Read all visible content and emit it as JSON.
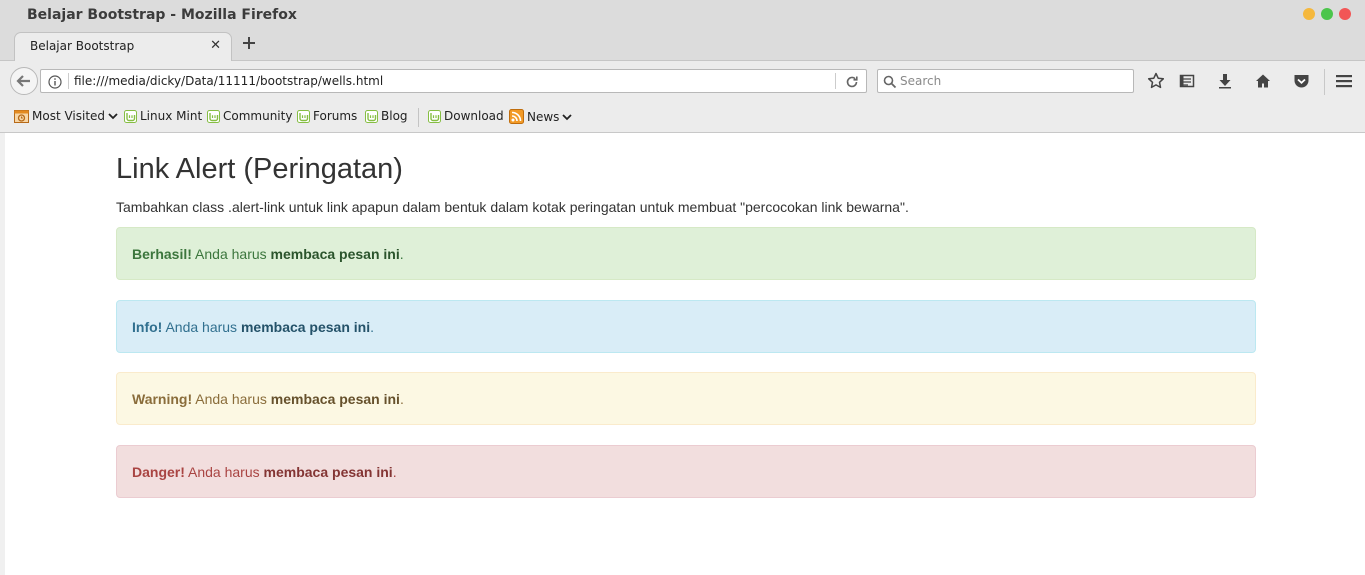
{
  "window": {
    "title": "Belajar Bootstrap - Mozilla Firefox",
    "controls": [
      {
        "name": "minimize",
        "color": "#f5b83d"
      },
      {
        "name": "maximize",
        "color": "#4cc54c"
      },
      {
        "name": "close",
        "color": "#f25656"
      }
    ]
  },
  "tab": {
    "label": "Belajar Bootstrap",
    "close": "✕"
  },
  "navbar": {
    "url": "file:///media/dicky/Data/11111/bootstrap/wells.html",
    "search_placeholder": "Search"
  },
  "bookmarks": [
    {
      "label": "Most Visited",
      "icon": "most-visited-icon",
      "dropdown": true
    },
    {
      "label": "Linux Mint",
      "icon": "mint-icon"
    },
    {
      "label": "Community",
      "icon": "mint-icon"
    },
    {
      "label": "Forums",
      "icon": "mint-icon"
    },
    {
      "label": "Blog",
      "icon": "mint-icon"
    },
    {
      "label": "Download",
      "icon": "mint-icon"
    },
    {
      "label": "News",
      "icon": "rss-icon",
      "dropdown": true
    }
  ],
  "page": {
    "heading": "Link Alert (Peringatan)",
    "lead": "Tambahkan class .alert-link untuk link apapun dalam bentuk dalam kotak peringatan untuk membuat \"percocokan link bewarna\".",
    "alerts": [
      {
        "strong": "Berhasil!",
        "text": " Anda harus ",
        "link": "membaca pesan ini",
        "end": "."
      },
      {
        "strong": "Info!",
        "text": " Anda harus ",
        "link": "membaca pesan ini",
        "end": "."
      },
      {
        "strong": "Warning!",
        "text": " Anda harus ",
        "link": "membaca pesan ini",
        "end": "."
      },
      {
        "strong": "Danger!",
        "text": " Anda harus ",
        "link": "membaca pesan ini",
        "end": "."
      }
    ]
  },
  "colors": {
    "success_bg": "#dff0d8",
    "info_bg": "#d9edf7",
    "warning_bg": "#fcf8e3",
    "danger_bg": "#f2dede"
  }
}
